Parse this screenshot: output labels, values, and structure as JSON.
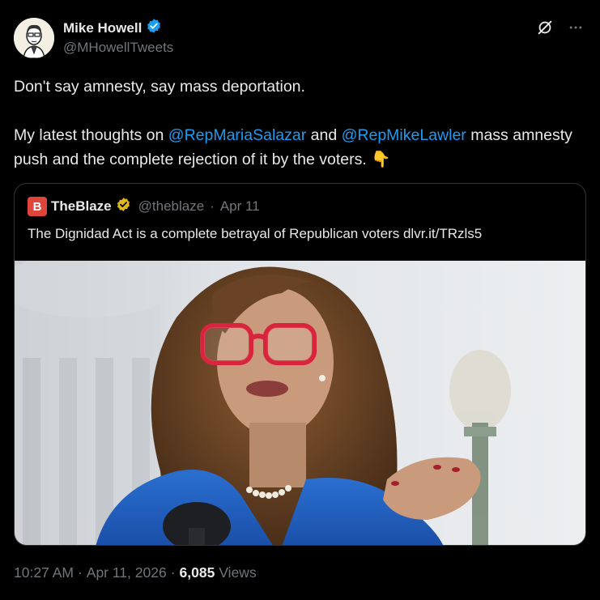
{
  "author": {
    "name": "Mike Howell",
    "handle": "@MHowellTweets",
    "verified_color": "#1d9bf0"
  },
  "tweet": {
    "line1": "Don't say amnesty, say mass deportation.",
    "line2_prefix": "My latest thoughts on ",
    "mention1": "@RepMariaSalazar",
    "line2_mid": " and ",
    "mention2": "@RepMikeLawler",
    "line2_suffix": " mass amnesty push and the complete rejection of it by the voters. ",
    "emoji": "👇"
  },
  "quote": {
    "name": "TheBlaze",
    "handle": "@theblaze",
    "separator": "·",
    "date": "Apr 11",
    "text": "The Dignidad Act is a complete betrayal of Republican voters dlvr.it/TRzls5",
    "logo_glyph": "B",
    "verified_color": "#e2b719"
  },
  "footer": {
    "time": "10:27 AM",
    "sep1": "·",
    "date": "Apr 11, 2026",
    "sep2": "·",
    "views_count": "6,085",
    "views_label": "Views"
  },
  "icons": [
    "grok-icon",
    "more-icon",
    "verified-badge-icon"
  ]
}
